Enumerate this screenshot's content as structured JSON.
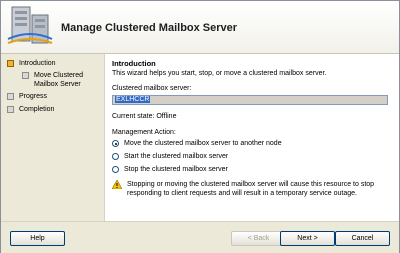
{
  "window": {
    "title": "Manage Clustered Mailbox Server"
  },
  "sidebar": {
    "steps": [
      {
        "label": "Introduction",
        "active": true
      },
      {
        "label": "Move Clustered Mailbox Server",
        "sub": true
      },
      {
        "label": "Progress"
      },
      {
        "label": "Completion"
      }
    ]
  },
  "content": {
    "heading": "Introduction",
    "description": "This wizard helps you start, stop, or move a clustered mailbox server.",
    "server_label": "Clustered mailbox server:",
    "server_value": "EXLHCCR",
    "current_state": "Current state: Offline",
    "action_label": "Management Action:",
    "options": [
      {
        "label": "Move the clustered mailbox server to another node",
        "checked": true
      },
      {
        "label": "Start the clustered mailbox server",
        "checked": false
      },
      {
        "label": "Stop the clustered mailbox server",
        "checked": false
      }
    ],
    "warning": "Stopping or moving the clustered mailbox server will cause this resource to stop responding to client requests and will result in a temporary service outage."
  },
  "footer": {
    "help": "Help",
    "back": "< Back",
    "next": "Next >",
    "cancel": "Cancel"
  },
  "colors": {
    "active_step": "#f1b33b",
    "selection": "#316ac5"
  }
}
